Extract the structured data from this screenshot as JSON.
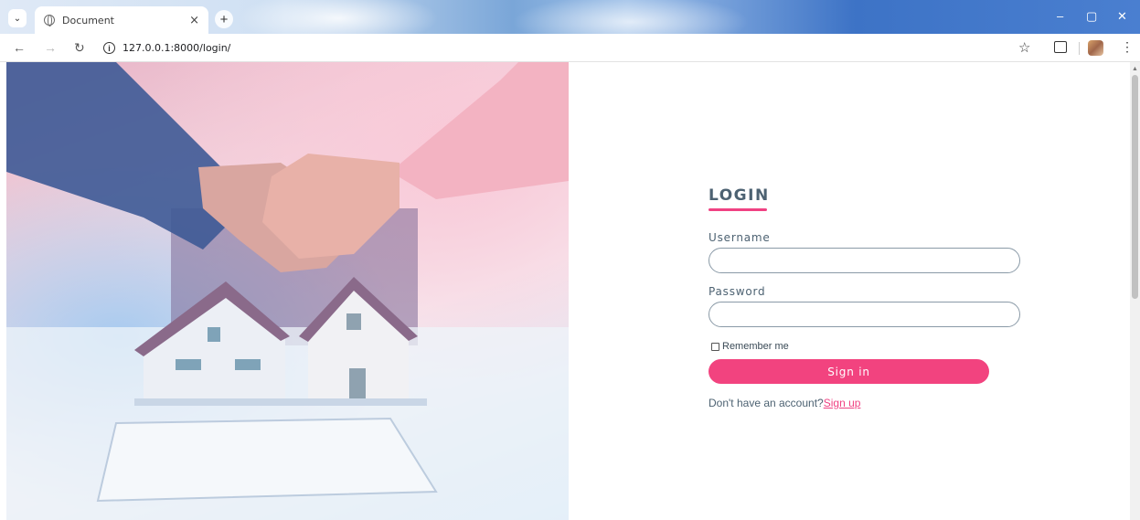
{
  "browser": {
    "tab_title": "Document",
    "tab_close": "×",
    "new_tab": "+",
    "url": "127.0.0.1:8000/login/",
    "window_controls": {
      "minimize": "–",
      "restore": "▢",
      "close": "✕"
    }
  },
  "login": {
    "heading": "LOGIN",
    "username_label": "Username",
    "username_value": "",
    "password_label": "Password",
    "password_value": "",
    "remember_label": "Remember me",
    "signin_label": "Sign in",
    "signup_prompt": "Don't have an account?",
    "signup_link": "Sign up"
  },
  "colors": {
    "accent": "#f2437f",
    "heading": "#4d6272"
  }
}
